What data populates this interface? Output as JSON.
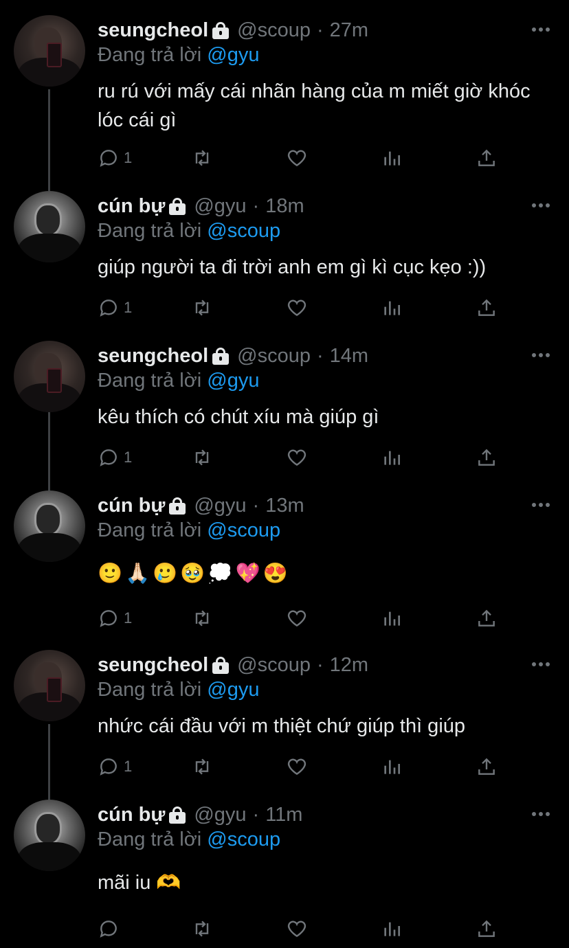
{
  "tweets": [
    {
      "name": "seungcheol",
      "handle": "@scoup",
      "time": "27m",
      "reply_prefix": "Đang trả lời",
      "reply_to": "@gyu",
      "text": "ru rú với mấy cái nhãn hàng của m miết giờ khóc lóc cái gì",
      "reply_count": "1"
    },
    {
      "name": "cún bự",
      "handle": "@gyu",
      "time": "18m",
      "reply_prefix": "Đang trả lời",
      "reply_to": "@scoup",
      "text": "giúp người ta đi trời anh em gì kì cục kẹo :))",
      "reply_count": "1"
    },
    {
      "name": "seungcheol",
      "handle": "@scoup",
      "time": "14m",
      "reply_prefix": "Đang trả lời",
      "reply_to": "@gyu",
      "text": "kêu thích có chút xíu mà giúp gì",
      "reply_count": "1"
    },
    {
      "name": "cún bự",
      "handle": "@gyu",
      "time": "13m",
      "reply_prefix": "Đang trả lời",
      "reply_to": "@scoup",
      "text": "🙂🙏🏻🥲🥹💭💖😍",
      "reply_count": "1"
    },
    {
      "name": "seungcheol",
      "handle": "@scoup",
      "time": "12m",
      "reply_prefix": "Đang trả lời",
      "reply_to": "@gyu",
      "text": "nhức cái đầu với m thiệt chứ giúp thì giúp",
      "reply_count": "1"
    },
    {
      "name": "cún bự",
      "handle": "@gyu",
      "time": "11m",
      "reply_prefix": "Đang trả lời",
      "reply_to": "@scoup",
      "text": "mãi iu 🫶",
      "reply_count": ""
    }
  ],
  "colors": {
    "background": "#000000",
    "text": "#e7e9ea",
    "muted": "#71767b",
    "link": "#1d9bf0"
  },
  "icons": [
    "reply-icon",
    "retweet-icon",
    "like-icon",
    "views-icon",
    "share-icon",
    "lock-icon",
    "more-icon"
  ]
}
